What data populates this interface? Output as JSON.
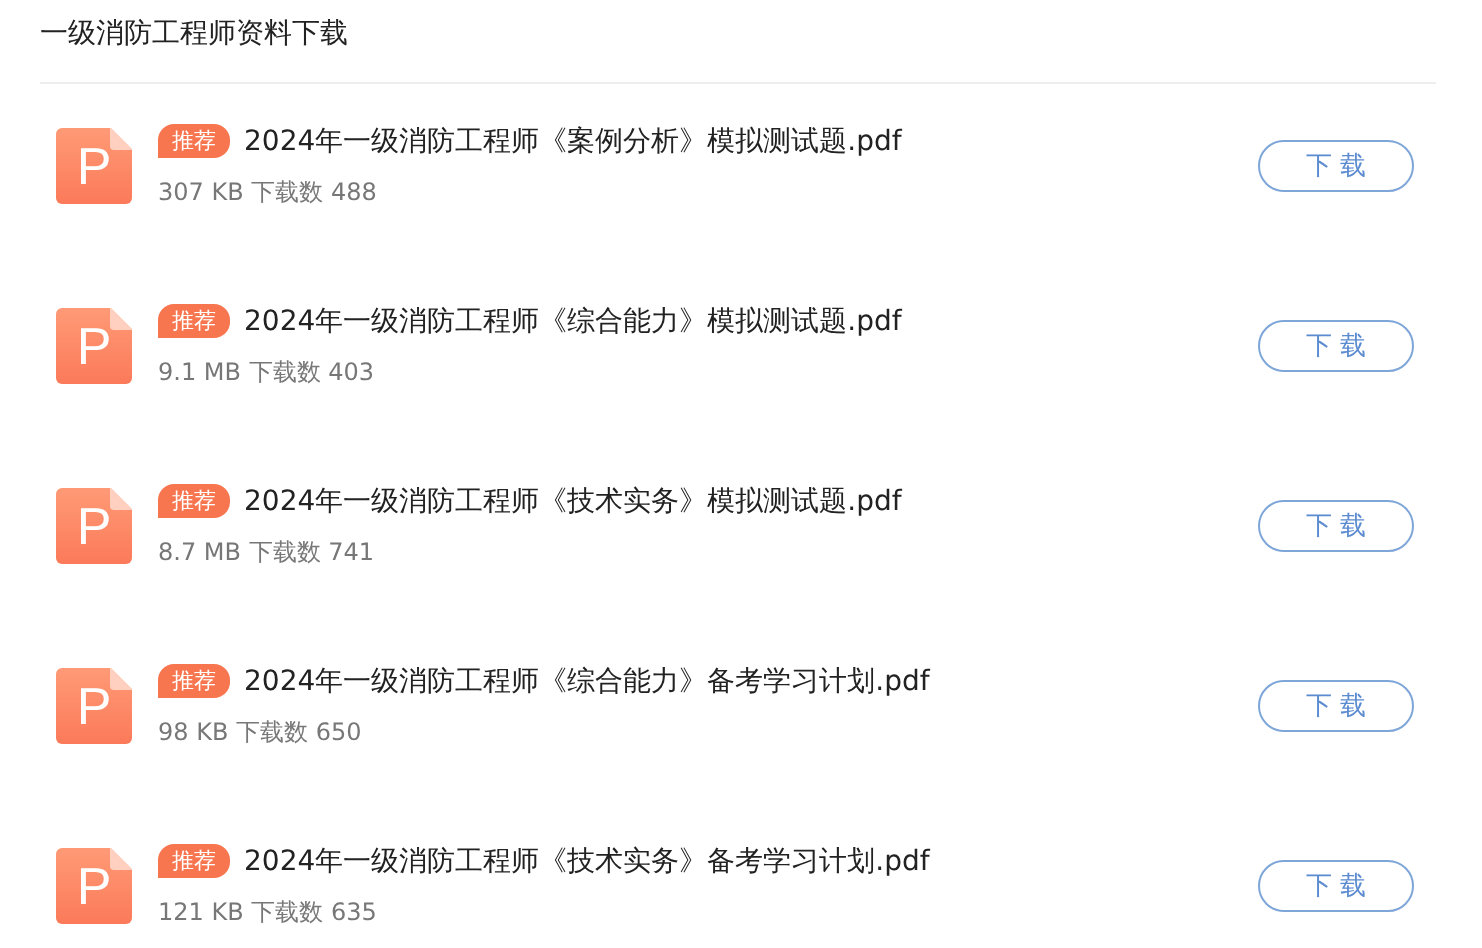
{
  "title": "一级消防工程师资料下载",
  "files": [
    {
      "icon_letter": "P",
      "badge": "推荐",
      "name": "2024年一级消防工程师《案例分析》模拟测试题.pdf",
      "meta": "307 KB 下载数 488",
      "button": "下 载"
    },
    {
      "icon_letter": "P",
      "badge": "推荐",
      "name": "2024年一级消防工程师《综合能力》模拟测试题.pdf",
      "meta": "9.1 MB 下载数 403",
      "button": "下 载"
    },
    {
      "icon_letter": "P",
      "badge": "推荐",
      "name": "2024年一级消防工程师《技术实务》模拟测试题.pdf",
      "meta": "8.7 MB 下载数 741",
      "button": "下 载"
    },
    {
      "icon_letter": "P",
      "badge": "推荐",
      "name": "2024年一级消防工程师《综合能力》备考学习计划.pdf",
      "meta": "98 KB 下载数 650",
      "button": "下 载"
    },
    {
      "icon_letter": "P",
      "badge": "推荐",
      "name": "2024年一级消防工程师《技术实务》备考学习计划.pdf",
      "meta": "121 KB 下载数 635",
      "button": "下 载"
    }
  ]
}
